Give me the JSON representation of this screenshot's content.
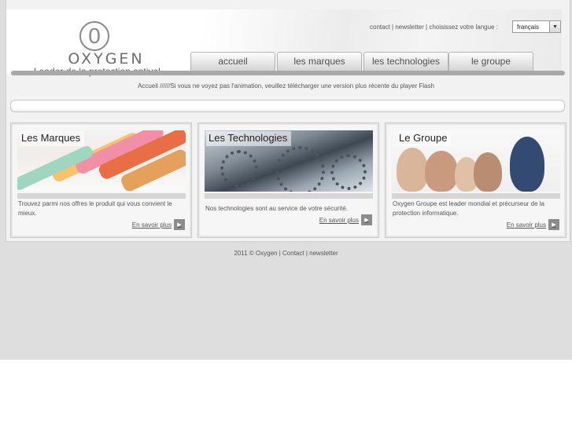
{
  "logo": {
    "symbol": "0",
    "word": "OXYGEN",
    "tagline": "Leader de la protection antivol"
  },
  "toplinks": {
    "contact": "contact",
    "newsletter": "newsletter",
    "language_prompt": "choisissez votre langue :",
    "separator": " | "
  },
  "language_select": {
    "value": "français"
  },
  "nav": {
    "tabs": [
      {
        "label": "accueil"
      },
      {
        "label": "les marques"
      },
      {
        "label": "les technologies"
      },
      {
        "label": "le groupe"
      }
    ]
  },
  "notice": "Accueil //////Si vous ne voyez pas l'animation, veuillez télécharger une version plus récente du player Flash",
  "boxes": [
    {
      "title": "Les Marques",
      "description": "Trouvez parmi nos offres le produit qui vous convient le mieux.",
      "more_label": "En savoir plus"
    },
    {
      "title": "Les Technologies",
      "description": "Nos technologies sont au service de votre sécurité.",
      "more_label": "En savoir plus"
    },
    {
      "title": "Le Groupe",
      "description": "Oxygen Groupe est leader mondial et précurseur de la protection informatique.",
      "more_label": "En savoir plus"
    }
  ],
  "footer": {
    "copyright": "2011 © Oxygen",
    "contact": "Contact",
    "newsletter": "newsletter"
  },
  "colors": {
    "page_bg": "#f2f2f2",
    "backdrop": "#dedede",
    "bar": "#a8a8a8",
    "text": "#555555"
  }
}
